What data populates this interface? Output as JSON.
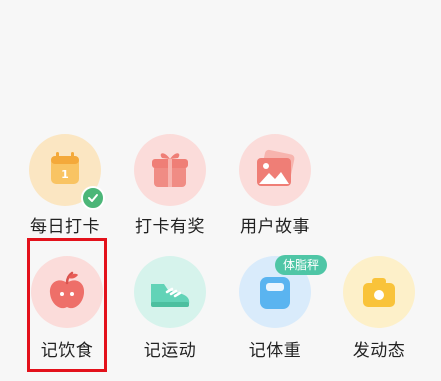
{
  "grid": {
    "row1": [
      {
        "label": "每日打卡",
        "icon": "calendar-icon",
        "bg": "#fbe6c2",
        "accent": "#f7b955",
        "calendar_day": "1",
        "status_icon": "check-icon"
      },
      {
        "label": "打卡有奖",
        "icon": "gift-icon",
        "bg": "#fbdcda",
        "accent": "#ef7e76"
      },
      {
        "label": "用户故事",
        "icon": "photo-icon",
        "bg": "#fbdcda",
        "accent": "#ef7e76"
      }
    ],
    "row2": [
      {
        "label": "记饮食",
        "icon": "apple-icon",
        "bg": "#fbdcda",
        "accent": "#ee6f69"
      },
      {
        "label": "记运动",
        "icon": "sneaker-icon",
        "bg": "#d6f3ec",
        "accent": "#62d3b7"
      },
      {
        "label": "记体重",
        "icon": "scale-icon",
        "bg": "#d9ebfb",
        "accent": "#5ab4f0",
        "badge": "体脂秤"
      },
      {
        "label": "发动态",
        "icon": "camera-icon",
        "bg": "#fdf0c9",
        "accent": "#f9c33a"
      }
    ]
  },
  "selection": {
    "highlight_color": "#e3111b"
  },
  "check_color": "#4cb678",
  "badge_color": "#4fc6a6"
}
